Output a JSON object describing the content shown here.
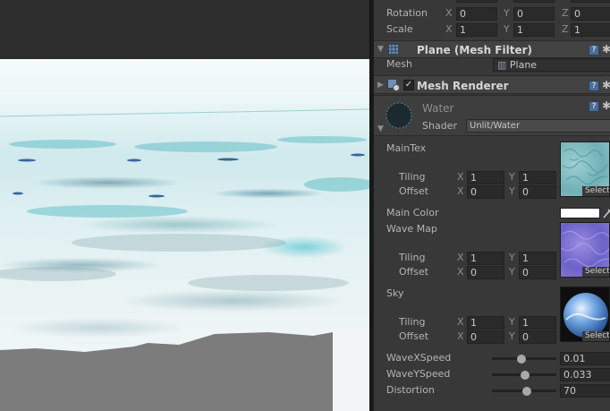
{
  "transform": {
    "rotation": {
      "label": "Rotation",
      "x": "0",
      "y": "0",
      "z": "0"
    },
    "scale": {
      "label": "Scale",
      "x": "1",
      "y": "1",
      "z": "1"
    },
    "axes": {
      "x": "X",
      "y": "Y",
      "z": "Z"
    }
  },
  "mesh_filter": {
    "title": "Plane (Mesh Filter)",
    "mesh_label": "Mesh",
    "mesh_value": "Plane"
  },
  "mesh_renderer": {
    "title": "Mesh Renderer",
    "enabled": true
  },
  "material": {
    "name": "Water",
    "shader_label": "Shader",
    "shader_value": "Unlit/Water",
    "main_tex": {
      "label": "MainTex",
      "tiling_label": "Tiling",
      "offset_label": "Offset",
      "tiling_x": "1",
      "tiling_y": "1",
      "offset_x": "0",
      "offset_y": "0"
    },
    "main_color": {
      "label": "Main Color",
      "value": "#ffffff"
    },
    "wave_map": {
      "label": "Wave Map",
      "tiling_label": "Tiling",
      "offset_label": "Offset",
      "tiling_x": "1",
      "tiling_y": "1",
      "offset_x": "0",
      "offset_y": "0"
    },
    "sky": {
      "label": "Sky",
      "tiling_label": "Tiling",
      "offset_label": "Offset",
      "tiling_x": "1",
      "tiling_y": "1",
      "offset_x": "0",
      "offset_y": "0"
    },
    "select_label": "Select",
    "wave_x_speed": {
      "label": "WaveXSpeed",
      "value": "0.01",
      "level": 0.45
    },
    "wave_y_speed": {
      "label": "WaveYSpeed",
      "value": "0.033",
      "level": 0.52
    },
    "distortion": {
      "label": "Distortion",
      "value": "70",
      "level": 0.55
    }
  },
  "icons": {
    "help": "?",
    "gear": "✱",
    "fold_open": "▼",
    "fold_closed": "▶",
    "check": "✓"
  },
  "colors": {
    "panel": "#383838",
    "header": "#424242",
    "field": "#2a2a2a",
    "accent": "#4a6c9a"
  }
}
